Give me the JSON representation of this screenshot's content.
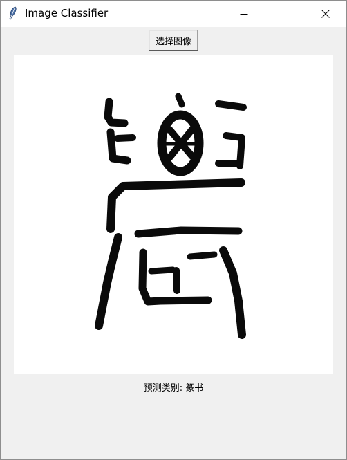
{
  "window": {
    "title": "Image Classifier",
    "app_icon": "feather-icon"
  },
  "controls": {
    "minimize": "minimize-icon",
    "maximize": "maximize-icon",
    "close": "close-icon"
  },
  "toolbar": {
    "select_image_label": "选择图像"
  },
  "image_panel": {
    "content": "seal-script-character-image"
  },
  "result": {
    "prediction_text": "预测类别: 篆书"
  }
}
